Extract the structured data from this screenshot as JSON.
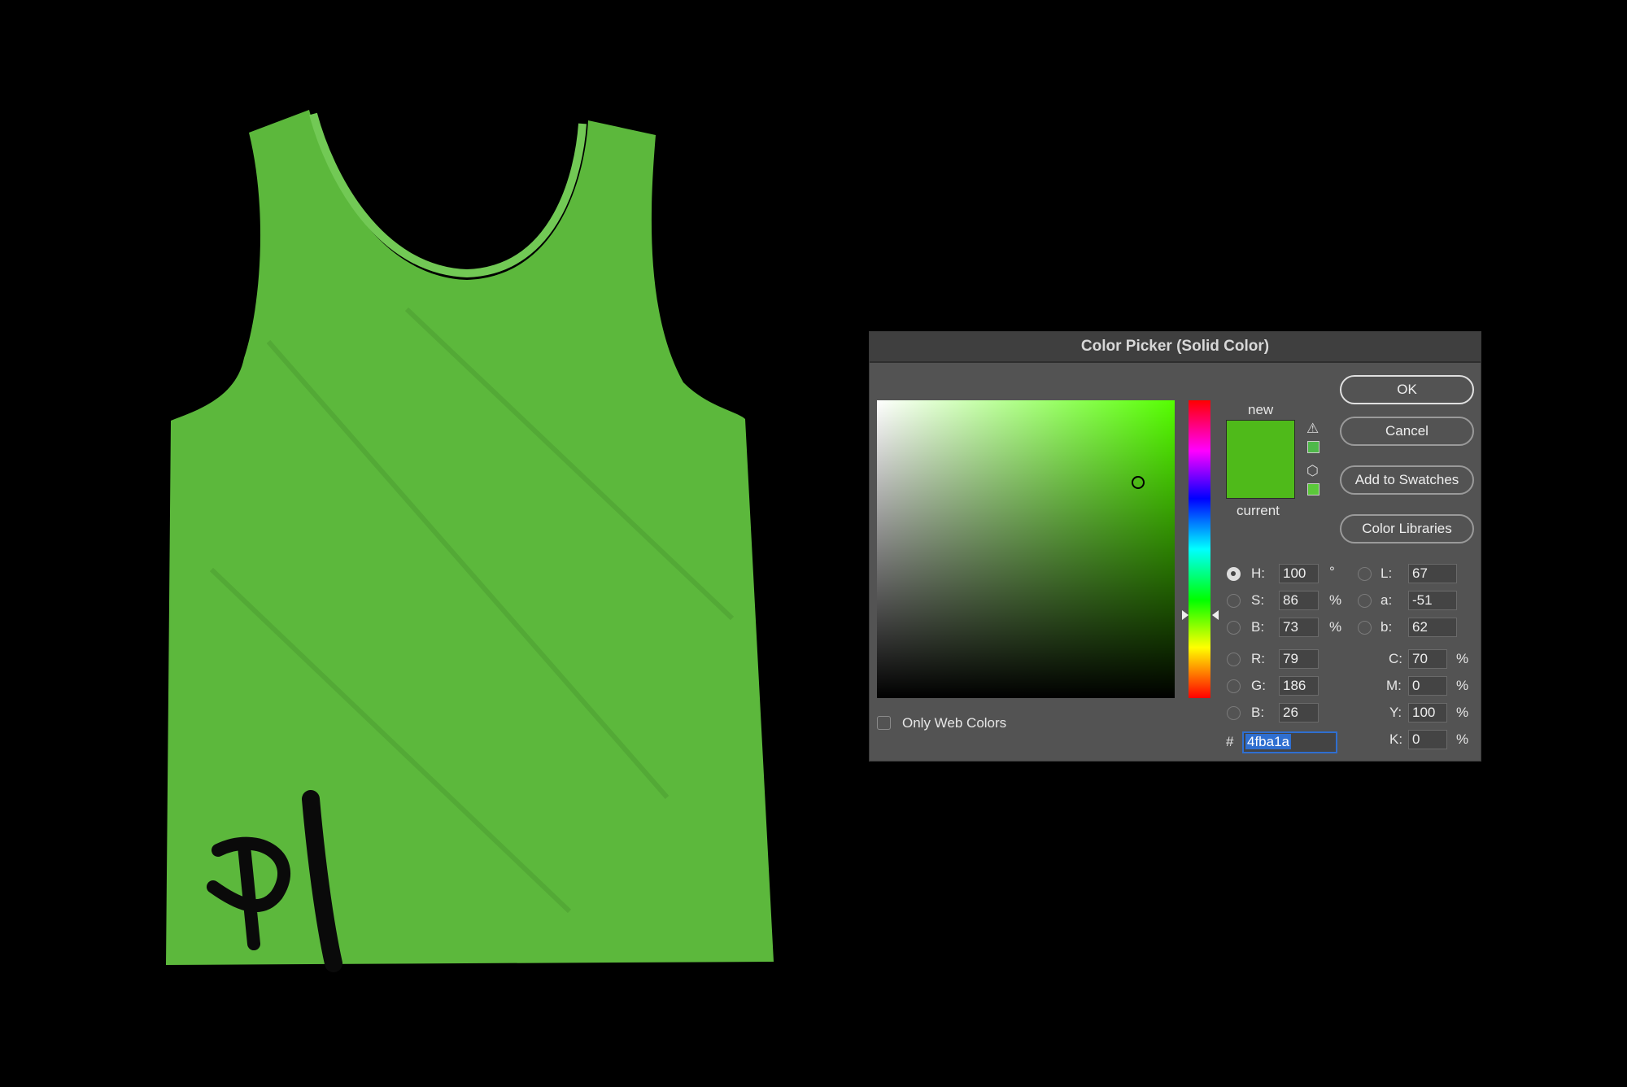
{
  "dialog": {
    "title": "Color Picker (Solid Color)",
    "buttons": {
      "ok": "OK",
      "cancel": "Cancel",
      "add_to_swatches": "Add to Swatches",
      "color_libraries": "Color Libraries"
    },
    "preview": {
      "new_label": "new",
      "current_label": "current",
      "new_color": "#4fba1a",
      "current_color": "#4fba1a",
      "gamut_swatch": "#4fb84a",
      "web_swatch": "#5bc83a"
    },
    "only_web_colors": {
      "label": "Only Web Colors",
      "checked": false
    },
    "selected_mode": "H",
    "hsb": [
      {
        "label": "H:",
        "value": "100",
        "unit": "°"
      },
      {
        "label": "S:",
        "value": "86",
        "unit": "%"
      },
      {
        "label": "B:",
        "value": "73",
        "unit": "%"
      }
    ],
    "rgb": [
      {
        "label": "R:",
        "value": "79"
      },
      {
        "label": "G:",
        "value": "186"
      },
      {
        "label": "B:",
        "value": "26"
      }
    ],
    "lab": [
      {
        "label": "L:",
        "value": "67"
      },
      {
        "label": "a:",
        "value": "-51"
      },
      {
        "label": "b:",
        "value": "62"
      }
    ],
    "cmyk": [
      {
        "label": "C:",
        "value": "70",
        "unit": "%"
      },
      {
        "label": "M:",
        "value": "0",
        "unit": "%"
      },
      {
        "label": "Y:",
        "value": "100",
        "unit": "%"
      },
      {
        "label": "K:",
        "value": "0",
        "unit": "%"
      }
    ],
    "hex": {
      "prefix": "#",
      "value": "4fba1a"
    }
  },
  "artwork": {
    "shirt_color": "#5cb83c",
    "tag_text": "P1"
  }
}
